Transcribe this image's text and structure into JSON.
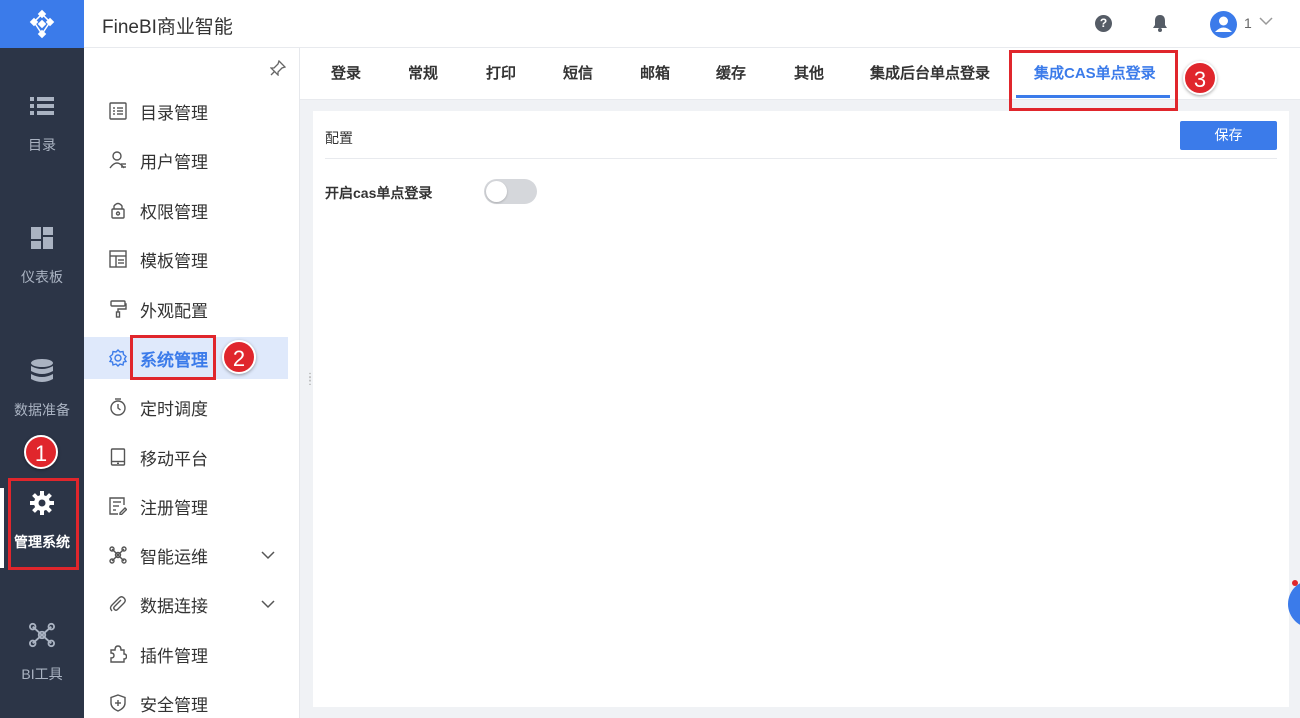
{
  "app": {
    "title": "FineBI商业智能",
    "user_name": "1"
  },
  "colors": {
    "accent": "#3b7bea",
    "rail_bg": "#2c3547",
    "annotation": "#e0262c"
  },
  "rail": {
    "items": [
      {
        "label": "目录",
        "icon": "list-icon"
      },
      {
        "label": "仪表板",
        "icon": "dashboard-icon"
      },
      {
        "label": "数据准备",
        "icon": "database-icon"
      },
      {
        "label": "管理系统",
        "icon": "gear-icon",
        "active": true
      },
      {
        "label": "BI工具",
        "icon": "network-icon"
      }
    ]
  },
  "sidebar": {
    "items": [
      {
        "label": "目录管理",
        "icon": "catalog-icon"
      },
      {
        "label": "用户管理",
        "icon": "user-icon"
      },
      {
        "label": "权限管理",
        "icon": "lock-icon"
      },
      {
        "label": "模板管理",
        "icon": "template-icon"
      },
      {
        "label": "外观配置",
        "icon": "paint-roller-icon"
      },
      {
        "label": "系统管理",
        "icon": "gear-icon",
        "active": true
      },
      {
        "label": "定时调度",
        "icon": "timer-icon"
      },
      {
        "label": "移动平台",
        "icon": "tablet-icon"
      },
      {
        "label": "注册管理",
        "icon": "register-icon"
      },
      {
        "label": "智能运维",
        "icon": "ops-icon",
        "expandable": true
      },
      {
        "label": "数据连接",
        "icon": "paperclip-icon",
        "expandable": true
      },
      {
        "label": "插件管理",
        "icon": "puzzle-icon"
      },
      {
        "label": "安全管理",
        "icon": "shield-icon"
      }
    ]
  },
  "tabs": [
    "登录",
    "常规",
    "打印",
    "短信",
    "邮箱",
    "缓存",
    "其他",
    "集成后台单点登录",
    "集成CAS单点登录"
  ],
  "active_tab": "集成CAS单点登录",
  "panel": {
    "section_title": "配置",
    "save_label": "保存",
    "field_label": "开启cas单点登录",
    "cas_enabled": false
  },
  "annotations": {
    "badge_1": "1",
    "badge_2": "2",
    "badge_3": "3"
  }
}
